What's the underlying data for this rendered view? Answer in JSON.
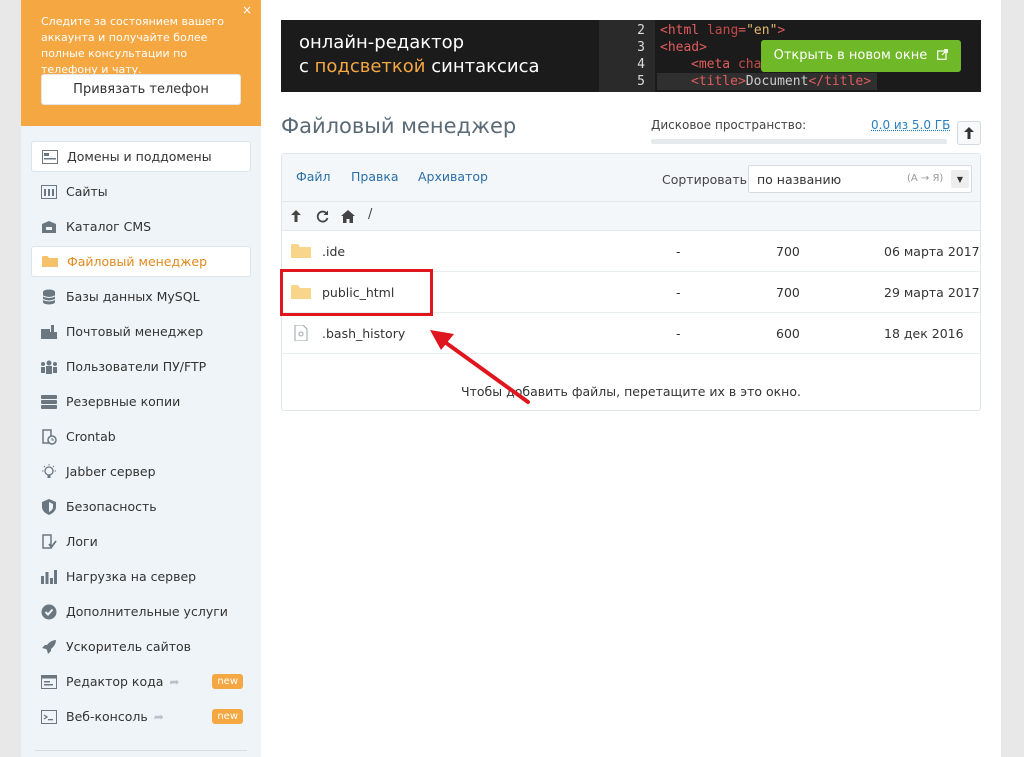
{
  "promo": {
    "text": "Следите за состоянием вашего аккаунта и получайте более полные консультации по телефону и чату.",
    "close": "×",
    "button": "Привязать телефон"
  },
  "menu": [
    {
      "label": "Домены и поддомены",
      "icon": "domains-icon"
    },
    {
      "label": "Сайты",
      "icon": "sites-icon"
    },
    {
      "label": "Каталог CMS",
      "icon": "cms-icon"
    },
    {
      "label": "Файловый менеджер",
      "icon": "folder-icon"
    },
    {
      "label": "Базы данных MySQL",
      "icon": "database-icon"
    },
    {
      "label": "Почтовый менеджер",
      "icon": "mail-icon"
    },
    {
      "label": "Пользователи ПУ/FTP",
      "icon": "users-icon"
    },
    {
      "label": "Резервные копии",
      "icon": "backup-icon"
    },
    {
      "label": "Crontab",
      "icon": "crontab-icon"
    },
    {
      "label": "Jabber сервер",
      "icon": "bulb-icon"
    },
    {
      "label": "Безопасность",
      "icon": "shield-icon"
    },
    {
      "label": "Логи",
      "icon": "logs-icon"
    },
    {
      "label": "Нагрузка на сервер",
      "icon": "chart-icon"
    },
    {
      "label": "Дополнительные услуги",
      "icon": "badge-icon"
    },
    {
      "label": "Ускоритель сайтов",
      "icon": "rocket-icon"
    },
    {
      "label": "Редактор кода",
      "icon": "code-editor-icon",
      "badge": "new"
    },
    {
      "label": "Веб-консоль",
      "icon": "console-icon",
      "badge": "new"
    }
  ],
  "banner": {
    "line1": "онлайн-редактор",
    "line2_pre": "с ",
    "line2_hl": "подсветкой",
    "line2_post": " синтаксиса",
    "button": "Открыть в новом окне",
    "code": {
      "n2": "2",
      "c2a": "<html ",
      "c2b": "lang",
      "c2c": "=",
      "c2d": "\"en\"",
      "c2e": ">",
      "n3": "3",
      "c3": "<head>",
      "n4": "4",
      "c4a": "<meta ",
      "c4b": "cha",
      "n5": "5",
      "c5a": "<title>",
      "c5b": "Document",
      "c5c": "</title>"
    }
  },
  "header": {
    "title": "Файловый менеджер",
    "disk_label": "Дисковое пространство:",
    "disk_value": "0.0 из 5.0 ГБ",
    "disk_used_fraction": 0
  },
  "fm": {
    "menu": [
      "Файл",
      "Правка",
      "Архиватор"
    ],
    "sort_label": "Сортировать:",
    "sort_value": "по названию",
    "sort_hint": "(А → Я)",
    "path": "/",
    "files": [
      {
        "name": ".ide",
        "type": "folder",
        "size": "-",
        "perm": "700",
        "date": "06 марта 2017"
      },
      {
        "name": "public_html",
        "type": "folder",
        "size": "-",
        "perm": "700",
        "date": "29 марта 2017"
      },
      {
        "name": ".bash_history",
        "type": "file",
        "size": "-",
        "perm": "600",
        "date": "18 дек 2016"
      }
    ],
    "drop_hint": "Чтобы добавить файлы, перетащите их в это окно."
  },
  "colors": {
    "accent": "#f5a742",
    "link": "#2a6fa8",
    "button_green": "#6fb827",
    "annotation_red": "#e0161f"
  }
}
